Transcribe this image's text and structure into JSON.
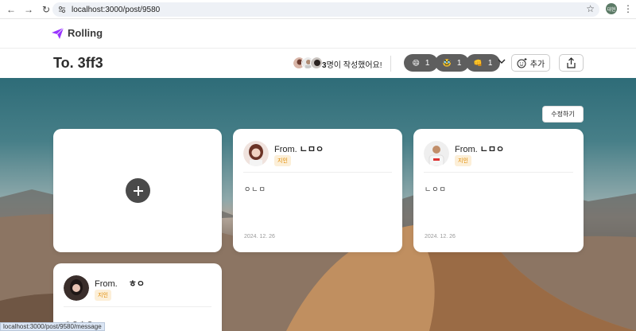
{
  "browser": {
    "url": "localhost:3000/post/9580",
    "profile_initials": "대현"
  },
  "app": {
    "logo_text": "Rolling"
  },
  "header": {
    "to_title": "To. 3ff3",
    "writer_count_number": "3",
    "writer_count_suffix": "명이 작성했어요!",
    "reactions": [
      {
        "emoji": "😄",
        "count": "1"
      },
      {
        "emoji": "🥸",
        "count": "1"
      },
      {
        "emoji": "👊",
        "count": "1"
      }
    ],
    "add_label": "추가"
  },
  "board": {
    "edit_label": "수정하기",
    "messages": [
      {
        "from_label": "From.",
        "sender": "ㄴㅁㅇ",
        "relation": "지인",
        "content": "ㅇㄴㅁ",
        "date": "2024. 12. 26"
      },
      {
        "from_label": "From.",
        "sender": "ㄴㅁㅇ",
        "relation": "지인",
        "content": "ㄴㅇㅁ",
        "date": "2024. 12. 26"
      },
      {
        "from_label": "From.",
        "sender": "ㅎㅇ",
        "relation": "지인",
        "content": "ㅎㅇㅎㅇ",
        "date": ""
      }
    ]
  },
  "status_bar": {
    "link": "localhost:3000/post/9580/message"
  },
  "colors": {
    "accent": "#9935ff",
    "reaction_bg": "#5e5e5e",
    "relation_text": "#e08a00"
  }
}
